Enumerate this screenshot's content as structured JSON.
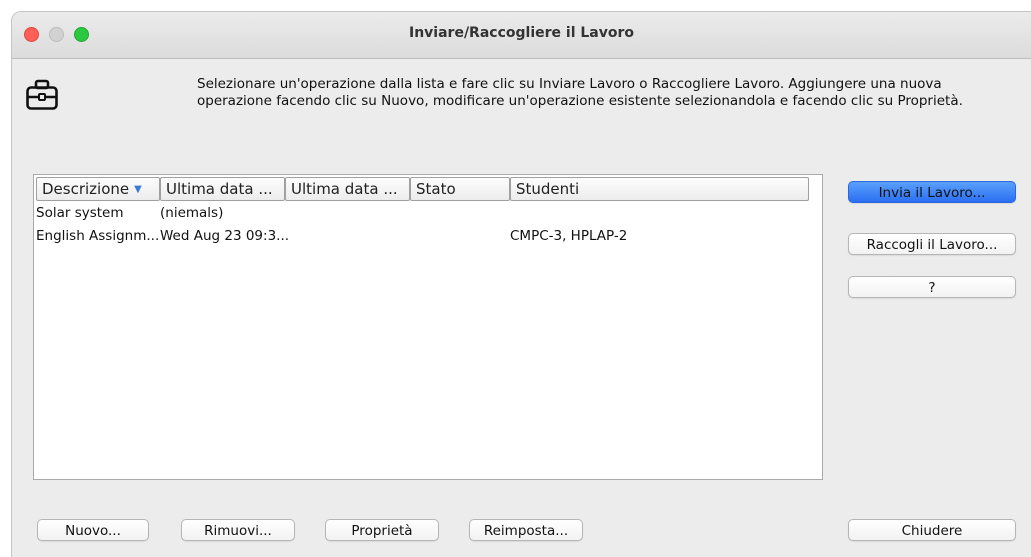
{
  "window": {
    "title": "Inviare/Raccogliere il Lavoro"
  },
  "instructions": {
    "line1": "Selezionare un'operazione dalla lista e fare clic su Inviare Lavoro o Raccogliere Lavoro. Aggiungere una nuova",
    "line2": "operazione facendo clic su Nuovo, modificare un'operazione esistente selezionandola e facendo clic su Proprietà."
  },
  "table": {
    "columns": [
      "Descrizione",
      "Ultima data ...",
      "Ultima data ...",
      "Stato",
      "Studenti"
    ],
    "sorted_column": 0,
    "rows": [
      [
        "Solar system",
        "(niemals)",
        "",
        "",
        ""
      ],
      [
        "English Assignm...",
        "Wed Aug 23 09:3...",
        "",
        "",
        "CMPC-3, HPLAP-2"
      ]
    ]
  },
  "side_buttons": {
    "send": "Invia il Lavoro...",
    "collect": "Raccogli il Lavoro...",
    "help": "?"
  },
  "bottom_buttons": {
    "new": "Nuovo...",
    "remove": "Rimuovi...",
    "properties": "Proprietà",
    "reset": "Reimposta...",
    "close": "Chiudere"
  },
  "colors": {
    "primary_button": "#2a6ff2",
    "window_bg": "#ececec",
    "sort_arrow": "#3a7bd5"
  },
  "icons": {
    "app_icon": "briefcase-icon"
  }
}
